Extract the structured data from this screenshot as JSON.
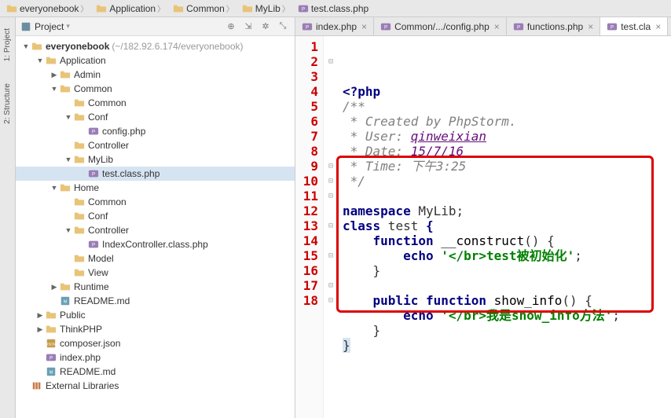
{
  "breadcrumb": [
    {
      "label": "everyonebook",
      "icon": "folder"
    },
    {
      "label": "Application",
      "icon": "folder"
    },
    {
      "label": "Common",
      "icon": "folder"
    },
    {
      "label": "MyLib",
      "icon": "folder"
    },
    {
      "label": "test.class.php",
      "icon": "php"
    }
  ],
  "vertical_tabs": [
    {
      "label": "1: Project",
      "icon": "project"
    },
    {
      "label": "2: Structure",
      "icon": "structure"
    }
  ],
  "project_panel_title": "Project",
  "tree": [
    {
      "d": 0,
      "t": "▼",
      "i": "folder",
      "l": "everyonebook",
      "s": "(~/182.92.6.174/everyonebook)",
      "bold": true
    },
    {
      "d": 1,
      "t": "▼",
      "i": "folder",
      "l": "Application"
    },
    {
      "d": 2,
      "t": "▶",
      "i": "folder",
      "l": "Admin"
    },
    {
      "d": 2,
      "t": "▼",
      "i": "folder",
      "l": "Common"
    },
    {
      "d": 3,
      "t": "",
      "i": "folder",
      "l": "Common"
    },
    {
      "d": 3,
      "t": "▼",
      "i": "folder",
      "l": "Conf"
    },
    {
      "d": 4,
      "t": "",
      "i": "php",
      "l": "config.php"
    },
    {
      "d": 3,
      "t": "",
      "i": "folder",
      "l": "Controller"
    },
    {
      "d": 3,
      "t": "▼",
      "i": "folder",
      "l": "MyLib"
    },
    {
      "d": 4,
      "t": "",
      "i": "php",
      "l": "test.class.php",
      "sel": true
    },
    {
      "d": 2,
      "t": "▼",
      "i": "folder",
      "l": "Home"
    },
    {
      "d": 3,
      "t": "",
      "i": "folder",
      "l": "Common"
    },
    {
      "d": 3,
      "t": "",
      "i": "folder",
      "l": "Conf"
    },
    {
      "d": 3,
      "t": "▼",
      "i": "folder",
      "l": "Controller"
    },
    {
      "d": 4,
      "t": "",
      "i": "php",
      "l": "IndexController.class.php"
    },
    {
      "d": 3,
      "t": "",
      "i": "folder",
      "l": "Model"
    },
    {
      "d": 3,
      "t": "",
      "i": "folder",
      "l": "View"
    },
    {
      "d": 2,
      "t": "▶",
      "i": "folder",
      "l": "Runtime"
    },
    {
      "d": 2,
      "t": "",
      "i": "md",
      "l": "README.md"
    },
    {
      "d": 1,
      "t": "▶",
      "i": "folder",
      "l": "Public"
    },
    {
      "d": 1,
      "t": "▶",
      "i": "folder",
      "l": "ThinkPHP"
    },
    {
      "d": 1,
      "t": "",
      "i": "json",
      "l": "composer.json"
    },
    {
      "d": 1,
      "t": "",
      "i": "php",
      "l": "index.php"
    },
    {
      "d": 1,
      "t": "",
      "i": "md",
      "l": "README.md"
    },
    {
      "d": 0,
      "t": "",
      "i": "lib",
      "l": "External Libraries"
    }
  ],
  "editor_tabs": [
    {
      "label": "index.php",
      "icon": "php",
      "active": false
    },
    {
      "label": "Common/.../config.php",
      "icon": "php",
      "active": false
    },
    {
      "label": "functions.php",
      "icon": "php",
      "active": false
    },
    {
      "label": "test.cla",
      "icon": "php",
      "active": true
    }
  ],
  "code_lines": [
    {
      "n": 1,
      "hl": true,
      "f": "",
      "html": "<span class='kw'>&lt;?php</span>"
    },
    {
      "n": 2,
      "hl": true,
      "f": "⊟",
      "html": "<span class='cm'>/**</span>"
    },
    {
      "n": 3,
      "hl": true,
      "f": "",
      "html": "<span class='cm'> * Created by PhpStorm.</span>"
    },
    {
      "n": 4,
      "hl": true,
      "f": "",
      "html": "<span class='cm'> * User: <span class='id'>qinweixian</span></span>"
    },
    {
      "n": 5,
      "hl": true,
      "f": "",
      "html": "<span class='cm'> * Date: <span class='id'>15/7/16</span></span>"
    },
    {
      "n": 6,
      "hl": true,
      "f": "",
      "html": "<span class='cm'> * Time: 下午3:25</span>"
    },
    {
      "n": 7,
      "hl": true,
      "f": "",
      "html": "<span class='cm'> */</span>"
    },
    {
      "n": 8,
      "hl": true,
      "f": "",
      "html": " "
    },
    {
      "n": 9,
      "hl": true,
      "f": "⊟",
      "html": "<span class='kw'>namespace</span> MyLib;"
    },
    {
      "n": 10,
      "hl": true,
      "f": "⊟",
      "html": "<span class='kw'>class</span> test <span class='kw'>{</span>"
    },
    {
      "n": 11,
      "hl": true,
      "f": "⊟",
      "html": "    <span class='kw'>function</span> <span class='fn'>__construct</span>() {"
    },
    {
      "n": 12,
      "hl": true,
      "f": "",
      "html": "        <span class='kw'>echo</span> <span class='str'>'&lt;/br&gt;test被初始化'</span>;"
    },
    {
      "n": 13,
      "hl": true,
      "f": "⊟",
      "html": "    }"
    },
    {
      "n": 14,
      "hl": true,
      "f": "",
      "html": " "
    },
    {
      "n": 15,
      "hl": true,
      "f": "⊟",
      "html": "    <span class='kw'>public function</span> <span class='fn'>show_info</span>() {"
    },
    {
      "n": 16,
      "hl": true,
      "f": "",
      "html": "        <span class='kw'>echo</span> <span class='str'>'&lt;/br&gt;我是show_info方法'</span>;"
    },
    {
      "n": 17,
      "hl": true,
      "f": "⊟",
      "html": "    }"
    },
    {
      "n": 18,
      "hl": true,
      "f": "⊟",
      "html": "<span style='background:#d6e4f2'>}</span>"
    }
  ]
}
